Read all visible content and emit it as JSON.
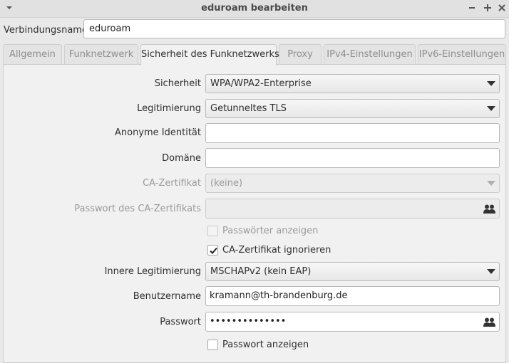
{
  "window": {
    "title": "eduroam bearbeiten"
  },
  "connection": {
    "label": "Verbindungsname",
    "value": "eduroam"
  },
  "tabs": [
    {
      "label": "Allgemein"
    },
    {
      "label": "Funknetzwerk"
    },
    {
      "label": "Sicherheit des Funknetzwerks",
      "active": true
    },
    {
      "label": "Proxy"
    },
    {
      "label": "IPv4-Einstellungen"
    },
    {
      "label": "IPv6-Einstellungen"
    }
  ],
  "form": {
    "security": {
      "label": "Sicherheit",
      "value": "WPA/WPA2-Enterprise"
    },
    "authentication": {
      "label": "Legitimierung",
      "value": "Getunneltes TLS"
    },
    "anonymous_identity": {
      "label": "Anonyme Identität",
      "value": ""
    },
    "domain": {
      "label": "Domäne",
      "value": ""
    },
    "ca_certificate": {
      "label": "CA-Zertifikat",
      "value": "(keine)"
    },
    "ca_cert_password": {
      "label": "Passwort des CA-Zertifikats",
      "value": ""
    },
    "show_passwords": {
      "label": "Passwörter anzeigen",
      "checked": false
    },
    "ignore_ca_cert": {
      "label": "CA-Zertifikat ignorieren",
      "checked": true
    },
    "inner_authentication": {
      "label": "Innere Legitimierung",
      "value": "MSCHAPv2 (kein EAP)"
    },
    "username": {
      "label": "Benutzername",
      "value": "kramann@th-brandenburg.de"
    },
    "password": {
      "label": "Passwort",
      "value": "••••••••••••••"
    },
    "show_password": {
      "label": "Passwort anzeigen",
      "checked": false
    }
  },
  "icons": {
    "window_menu": "chevron-down-icon",
    "minimize": "minimize-icon",
    "maximize": "maximize-icon",
    "close": "close-icon",
    "password_storage": "users-icon",
    "dropdown": "caret-down-icon"
  }
}
